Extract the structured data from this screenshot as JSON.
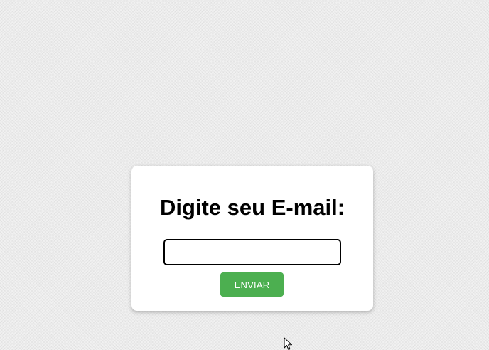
{
  "form": {
    "title": "Digite seu E-mail:",
    "email_value": "",
    "email_placeholder": "",
    "submit_label": "ENVIAR"
  },
  "colors": {
    "button_bg": "#4caf50",
    "button_text": "#ffffff",
    "card_bg": "#ffffff",
    "page_bg": "#f1f1f1"
  },
  "icons": {
    "cursor": "arrow-pointer-icon"
  }
}
